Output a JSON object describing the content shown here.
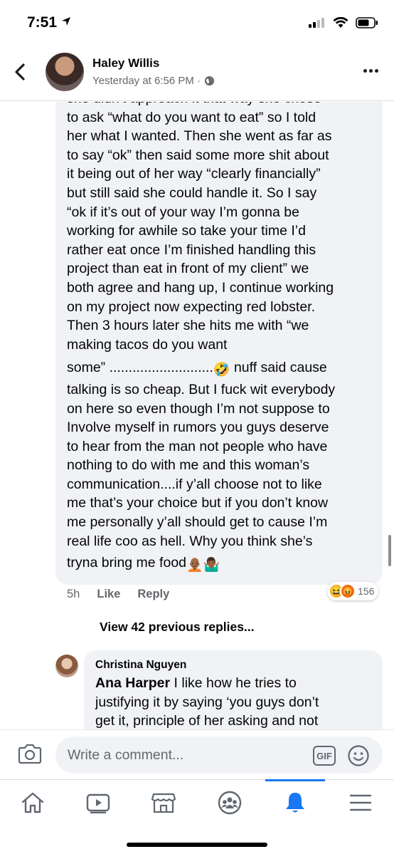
{
  "status": {
    "time": "7:51"
  },
  "header": {
    "name": "Haley Willis",
    "timestamp": "Yesterday at 6:56 PM ·"
  },
  "comment": {
    "lines": [
      "she didn’t approach it that way she chose",
      "to ask “what do you want to eat” so I told",
      "her what I wanted.  Then she went as far as",
      "to say “ok” then said some more shit about",
      "it being out of her way “clearly financially”",
      "but still said she could handle it. So I say",
      "“ok if it’s out of your way I’m gonna be",
      "working for awhile so take your time I’d",
      "rather eat once I’m finished handling this",
      "project than eat in front of my client” we",
      "both agree and hang up, I continue working",
      "on my project now expecting red lobster.",
      "Then 3 hours later she hits me with “we",
      "making tacos do you want"
    ],
    "line_some": "some” ...........................",
    "line_some_after": " nuff said cause",
    "lines2": [
      "talking is so cheap. But I fuck wit everybody",
      "on here so even though I’m not suppose to",
      "Involve myself in rumors you guys deserve",
      "to hear from the man not people who have",
      "nothing to do with me and this woman’s",
      "communication....if y’all choose not to like",
      "me that’s your choice but if you don’t know",
      "me personally y’all should get to cause I’m",
      "real life coo as hell. Why you think she’s"
    ],
    "last_line": "tryna bring me food",
    "emoji_rofl": "🤣",
    "emoji_person": "🧑🏾‍🦲",
    "emoji_shrug": "🤷🏾‍♂️",
    "time": "5h",
    "like_label": "Like",
    "reply_label": "Reply",
    "reaction_count": "156"
  },
  "view_previous": "View 42 previous replies...",
  "reply": {
    "author": "Christina Nguyen",
    "mention": "Ana Harper",
    "first_line_rest": " I like how he tries to",
    "lines": [
      "justifying it by saying ‘you guys don’t",
      "get it, principle of her asking and not"
    ]
  },
  "composer": {
    "placeholder": "Write a comment...",
    "gif_label": "GIF"
  }
}
